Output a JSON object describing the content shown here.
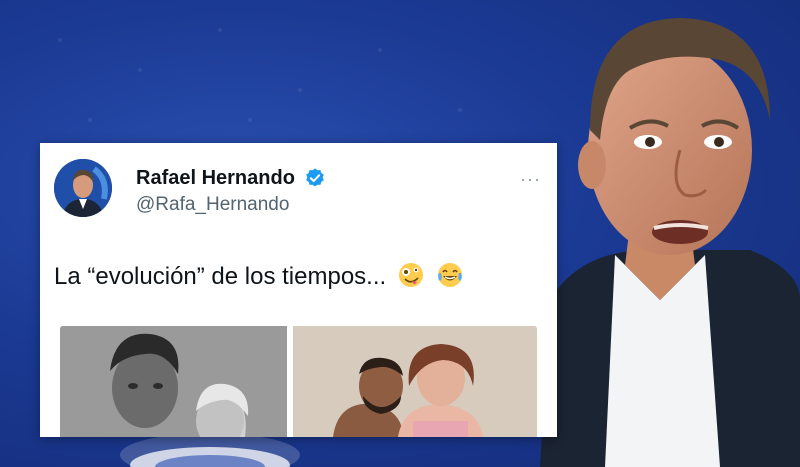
{
  "tweet": {
    "author_name": "Rafael Hernando",
    "handle": "@Rafa_Hernando",
    "more_label": "···",
    "text": "La “evolución” de los tiempos...",
    "emojis": [
      "zany-face-emoji",
      "tears-of-joy-emoji"
    ]
  },
  "colors": {
    "background_blue": "#1b3a94",
    "verified_blue": "#1d9bf0",
    "text_dark": "#0f1419",
    "text_muted": "#536471"
  }
}
